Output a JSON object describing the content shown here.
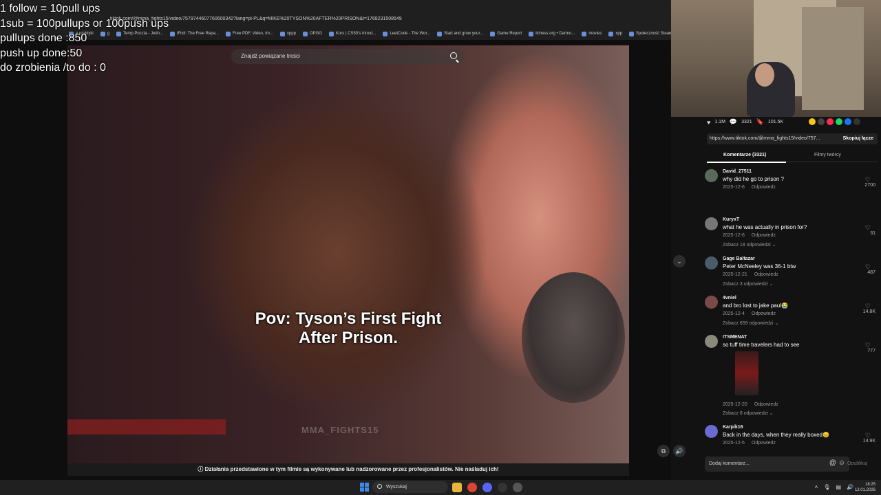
{
  "overlay": {
    "lines": [
      "1 follow = 10pull ups",
      "1sub = 100pullups or 100push ups",
      "pullups done :850",
      "push up done:50",
      "do zrobienia /to do : 0"
    ]
  },
  "browser": {
    "url": "tiktok.com/@mma_fights15/video/7579744607760600342?lang=pl-PL&q=MIKE%20TYSON%20AFTER%20PRISON&t=1768231508549",
    "bookmarks": [
      "e praktyki",
      "g",
      "Temp Poczta - Jedn...",
      "iFixit: The Free Repa...",
      "Free PDF, Video, Im...",
      "xppp",
      "OPGG",
      "Kurs | CS50's Introd...",
      "LeetCode - The Wor...",
      "Start and grow your...",
      "Game Report",
      "lichess.org • Darmo...",
      "movies",
      "xpp",
      "Społeczność Steam..."
    ]
  },
  "video": {
    "search_placeholder": "Znajdź powiązane treści",
    "caption_line1": "Pov: Tyson’s First Fight",
    "caption_line2": "After Prison.",
    "watermark": "MMA_FIGHTS15",
    "disclaimer": "Działania przedstawione w tym filmie są wykonywane lub nadzorowane przez profesjonalistów. Nie naśladuj ich!"
  },
  "stats": {
    "likes": "1.1M",
    "comments": "3321",
    "saves": "101.5K"
  },
  "link": {
    "url": "https://www.tiktok.com/@mma_fights15/video/757...",
    "copy_label": "Skopiuj łącze"
  },
  "tabs": {
    "comments": "Komentarze (3321)",
    "creator": "Filmy twórcy"
  },
  "reply_label": "Odpowiedz",
  "comments": [
    {
      "name": "David_27511",
      "text": "why did he go to prison ?",
      "date": "2025-12-6",
      "likes": "2700",
      "more": ""
    },
    {
      "name": "KuryxT",
      "text": "what he was actually in prison for?",
      "date": "2025-12-6",
      "likes": "31",
      "more": "Zobacz 18 odpowiedzi"
    },
    {
      "name": "Gage Baltazar",
      "text": "Peter McNeeley was 36-1 btw",
      "date": "2025-12-21",
      "likes": "487",
      "more": "Zobacz 3 odpowiedzi"
    },
    {
      "name": "4vniel",
      "text": "and bro lost to jake paul😭",
      "date": "2025-12-4",
      "likes": "14.8K",
      "more": "Zobacz 659 odpowiedzi"
    },
    {
      "name": "ITSMENAT",
      "text": "so tuff time travelers had to see",
      "date": "2025-12-20",
      "likes": "777",
      "more": "Zobacz 8 odpowiedzi"
    },
    {
      "name": "Karpik16",
      "text": "Back in the days, when they really boxed😊",
      "date": "2025-12-5",
      "likes": "14.9K",
      "more": ""
    }
  ],
  "add_comment": {
    "placeholder": "Dodaj komentarz...",
    "post": "Opublikuj"
  },
  "taskbar": {
    "search": "Wyszukaj",
    "time": "18:25",
    "date": "12.01.2026"
  },
  "colors": {
    "accent": "#fe2c55",
    "win_blue": "#3c8ce7"
  }
}
